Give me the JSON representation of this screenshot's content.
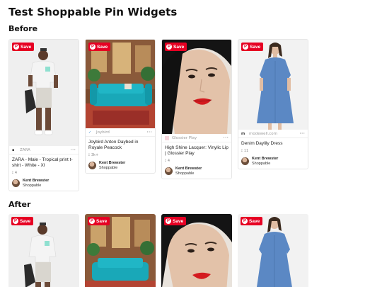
{
  "page": {
    "title": "Test Shoppable Pin Widgets"
  },
  "sections": {
    "before": "Before",
    "after": "After"
  },
  "save_label": "Save",
  "pins": [
    {
      "source": "ZARA",
      "title": "ZARA - Male - Tropical print t-shirt - White - XI",
      "count": "4",
      "user": "Kent Brewster",
      "board": "Shoppable"
    },
    {
      "source": "Joybird",
      "title": "Joybird Anton Daybed in Royale Peacock",
      "count": "3k+",
      "user": "Kent Brewster",
      "board": "Shoppable"
    },
    {
      "source": "Glossier Play",
      "title": "High Shine Lacquer: Vinylic Lip | Glossier Play",
      "count": "4",
      "user": "Kent Brewster",
      "board": "Shoppable"
    },
    {
      "source": "modewell.com",
      "title": "Denim Daylily Dress",
      "count": "11",
      "user": "Kent Brewster",
      "board": "Shoppable"
    }
  ],
  "colors": {
    "save": "#e60023"
  }
}
